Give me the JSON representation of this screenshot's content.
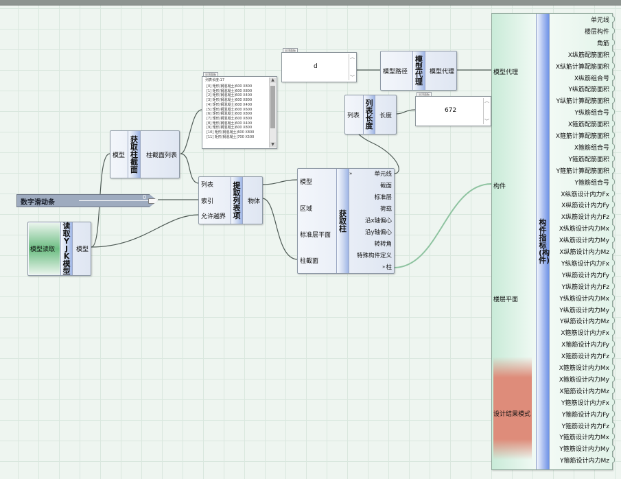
{
  "slider": {
    "label": "数字滑动条",
    "value": "0"
  },
  "read_model": {
    "title": "读取YJK模型",
    "input": "模型读取",
    "output": "模型"
  },
  "get_section": {
    "title": "获取柱截面",
    "input": "模型",
    "output": "柱截面列表"
  },
  "list_panel": {
    "tab": "尖顶面板",
    "header": "列表长度:17",
    "rows": [
      "[0] 矩形|钢混凝土|600 X800",
      "[1] 矩形|钢混凝土|600 X800",
      "[2] 矩形|钢混凝土|600 X400",
      "[3] 矩形|钢混凝土|600 X800",
      "[4] 矩形|钢混凝土|600 X400",
      "[5] 矩形|钢混凝土|600 X600",
      "[6] 矩形|钢混凝土|600 X800",
      "[7] 矩形|钢混凝土|600 X800",
      "[8] 矩形|钢混凝土|600 X400",
      "[9] 矩形|钢混凝土|600 X800",
      "[10] 矩形|钢混凝土|600 X800",
      "[11] 矩形|钢混凝土|700 X500"
    ]
  },
  "extract_item": {
    "title": "提取列表项",
    "inputs": [
      "列表",
      "索引",
      "允许越界"
    ],
    "output": "物体"
  },
  "text_panel": {
    "tab": "尖顶面板",
    "value": "d"
  },
  "model_proxy": {
    "title": "模型代理",
    "input": "模型路径",
    "output": "模型代理"
  },
  "list_length": {
    "title": "列表长度",
    "input": "列表",
    "output": "长度"
  },
  "length_panel": {
    "tab": "尖顶面板",
    "value": "672"
  },
  "get_column": {
    "title": "获取柱",
    "inputs": [
      "模型",
      "区域",
      "标准层平面",
      "柱截面"
    ],
    "outputs": [
      "单元线",
      "截面",
      "标准层",
      "荷载",
      "沿x轴偏心",
      "沿y轴偏心",
      "转转角",
      "特殊构件定义",
      "柱"
    ]
  },
  "indicator": {
    "title": "构件指标(构件)",
    "inputs": [
      "模型代理",
      "构件",
      "楼层平面",
      "设计结果模式"
    ],
    "outputs": [
      "单元线",
      "楼层构件",
      "角筋",
      "X纵筋配筋面积",
      "X纵筋计算配筋面积",
      "X纵筋组合号",
      "Y纵筋配筋面积",
      "Y纵筋计算配筋面积",
      "Y纵筋组合号",
      "X箍筋配筋面积",
      "X箍筋计算配筋面积",
      "X箍筋组合号",
      "Y箍筋配筋面积",
      "Y箍筋计算配筋面积",
      "Y箍筋组合号",
      "X纵筋设计内力Fx",
      "X纵筋设计内力Fy",
      "X纵筋设计内力Fz",
      "X纵筋设计内力Mx",
      "X纵筋设计内力My",
      "X纵筋设计内力Mz",
      "Y纵筋设计内力Fx",
      "Y纵筋设计内力Fy",
      "Y纵筋设计内力Fz",
      "Y纵筋设计内力Mx",
      "Y纵筋设计内力My",
      "Y纵筋设计内力Mz",
      "X箍筋设计内力Fx",
      "X箍筋设计内力Fy",
      "X箍筋设计内力Fz",
      "X箍筋设计内力Mx",
      "X箍筋设计内力My",
      "X箍筋设计内力Mz",
      "Y箍筋设计内力Fx",
      "Y箍筋设计内力Fy",
      "Y箍筋设计内力Fz",
      "Y箍筋设计内力Mx",
      "Y箍筋设计内力My",
      "Y箍筋设计内力Mz"
    ]
  },
  "colors": {
    "wire": "#4e5a55",
    "wire_selected": "#8ec3a0",
    "node_strip": "#9fb6e6",
    "slider": "#9eabbf"
  }
}
